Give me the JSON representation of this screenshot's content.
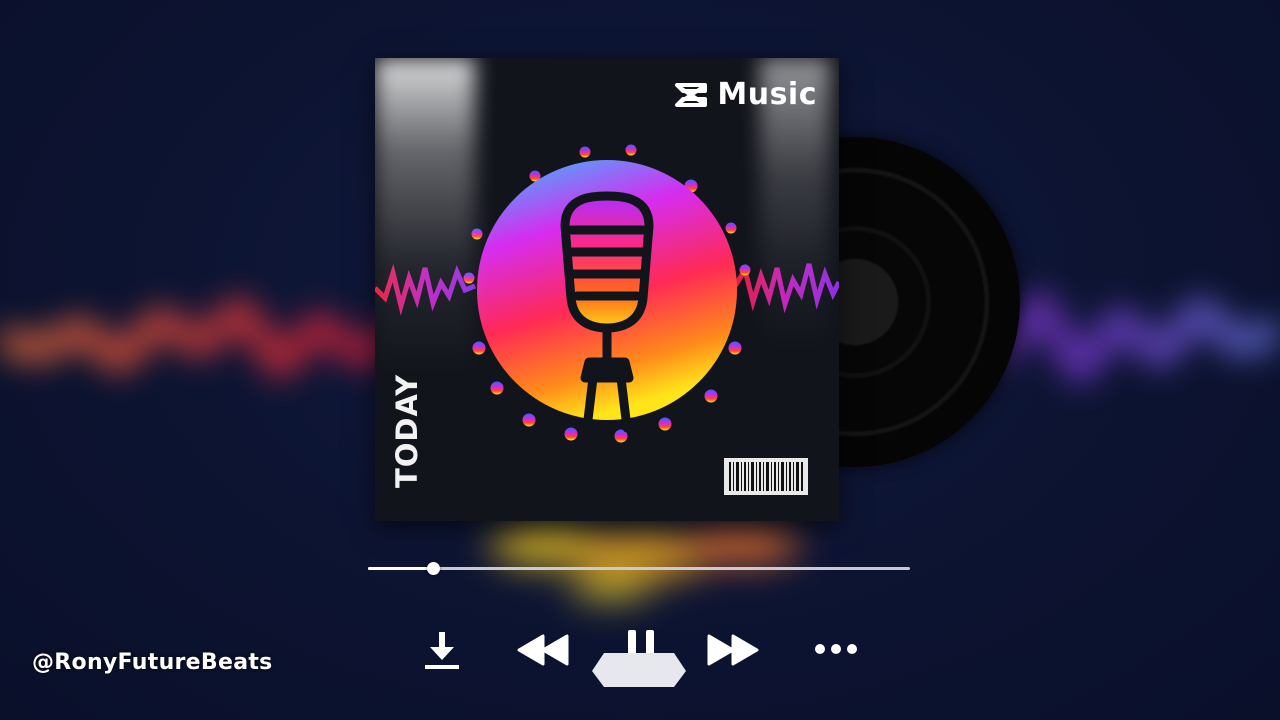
{
  "player": {
    "progress_fraction": 0.12
  },
  "cover": {
    "brand_text": "Music",
    "vertical_text": "TODAY"
  },
  "controls": {
    "download_icon": "download-icon",
    "rewind_icon": "rewind-icon",
    "pause_icon": "pause-icon",
    "fast_forward_icon": "fast-forward-icon",
    "more_icon": "more-options-icon"
  },
  "watermark": {
    "handle": "@RonyFutureBeats"
  },
  "colors": {
    "background": "#0d1433",
    "control_white": "#ffffff",
    "progress_track": "#c9cad1"
  }
}
